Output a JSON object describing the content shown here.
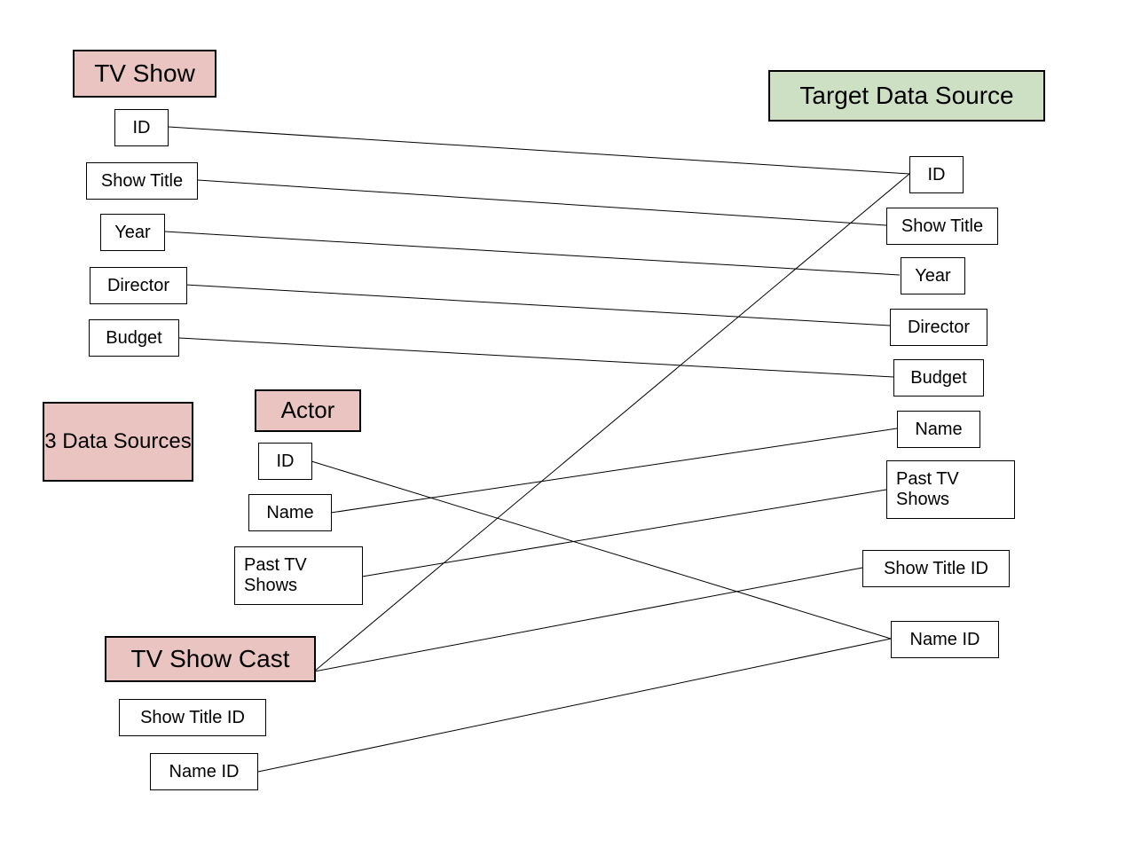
{
  "sources": {
    "tvshow": {
      "title": "TV Show",
      "fields": [
        "ID",
        "Show Title",
        "Year",
        "Director",
        "Budget"
      ]
    },
    "actor": {
      "title": "Actor",
      "fields": [
        "ID",
        "Name",
        "Past TV Shows"
      ]
    },
    "tvshowcast": {
      "title": "TV Show Cast",
      "fields": [
        "Show Title ID",
        "Name ID"
      ]
    }
  },
  "target": {
    "title": "Target Data Source",
    "fields": [
      "ID",
      "Show Title",
      "Year",
      "Director",
      "Budget",
      "Name",
      "Past TV Shows",
      "Show Title ID",
      "Name ID"
    ]
  },
  "note": "3 Data Sources",
  "mappings": [
    {
      "from": "tvshow.ID",
      "to": "target.ID"
    },
    {
      "from": "tvshow.Show Title",
      "to": "target.Show Title"
    },
    {
      "from": "tvshow.Year",
      "to": "target.Year"
    },
    {
      "from": "tvshow.Director",
      "to": "target.Director"
    },
    {
      "from": "tvshow.Budget",
      "to": "target.Budget"
    },
    {
      "from": "actor.ID",
      "to": "target.Name ID"
    },
    {
      "from": "actor.Name",
      "to": "target.Name"
    },
    {
      "from": "actor.Past TV Shows",
      "to": "target.Past TV Shows"
    },
    {
      "from": "tvshowcast.Show Title ID",
      "to": "target.ID"
    },
    {
      "from": "tvshowcast.Show Title ID",
      "to": "target.Show Title ID"
    },
    {
      "from": "tvshowcast.Name ID",
      "to": "target.Name ID"
    }
  ]
}
